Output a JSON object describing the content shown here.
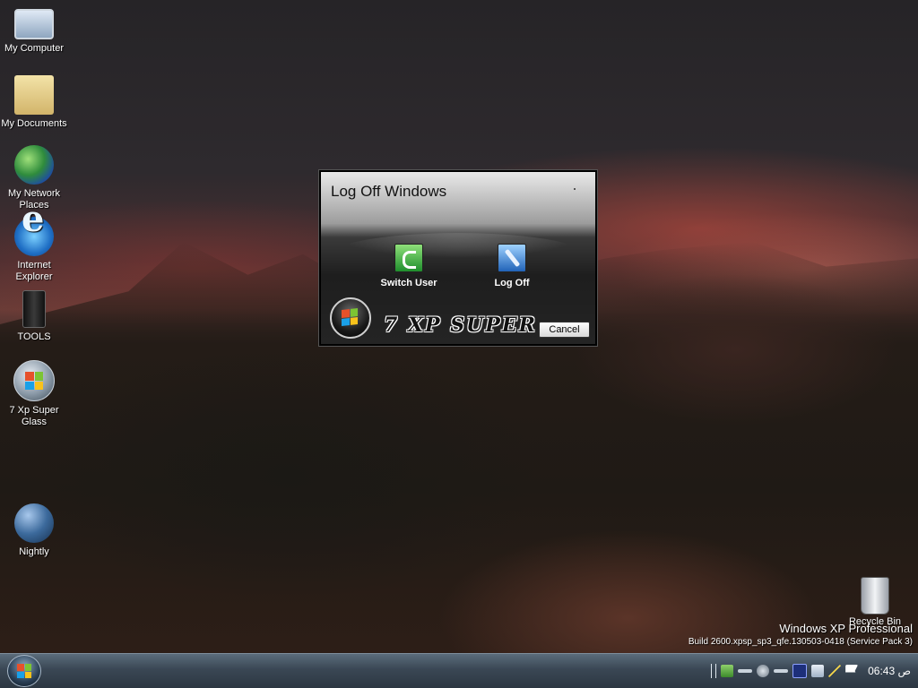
{
  "desktop": {
    "icons": [
      {
        "label": "My Computer",
        "icon": "computer-icon"
      },
      {
        "label": "My Documents",
        "icon": "folder-icon"
      },
      {
        "label_line1": "My Network",
        "label_line2": "Places",
        "icon": "network-globe-icon"
      },
      {
        "label_line1": "Internet",
        "label_line2": "Explorer",
        "icon": "internet-explorer-icon"
      },
      {
        "label": "TOOLS",
        "icon": "tools-icon"
      },
      {
        "label_line1": "7 Xp Super",
        "label_line2": "Glass",
        "icon": "windows-orb-icon"
      },
      {
        "label": "Nightly",
        "icon": "nightly-globe-icon"
      }
    ],
    "recycle_bin_label": "Recycle Bin"
  },
  "dialog": {
    "title": "Log Off Windows",
    "switch_user_label": "Switch User",
    "log_off_label": "Log Off",
    "brand_text": "7 XP SUPER",
    "cancel_label": "Cancel"
  },
  "watermark": {
    "line1": "Windows XP Professional",
    "line2": "Build 2600.xpsp_sp3_qfe.130503-0418 (Service Pack 3)"
  },
  "taskbar": {
    "clock_time": "06:43",
    "clock_ampm": "ص"
  },
  "colors": {
    "taskbar": "#3a4754",
    "dialog_bg": "#1e1e1e",
    "switch_user_green": "#1f8e2c",
    "log_off_blue": "#2163b8"
  }
}
